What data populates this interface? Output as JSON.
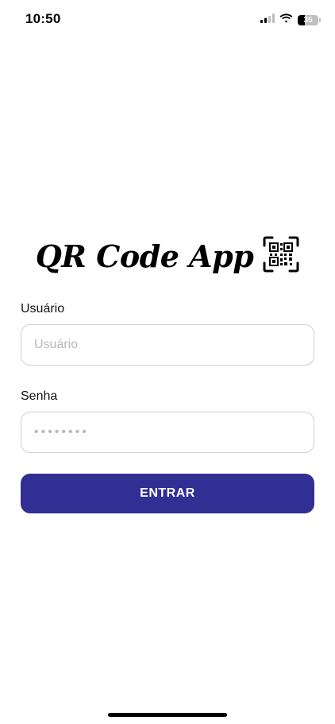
{
  "status_bar": {
    "time": "10:50",
    "battery_level": "35",
    "signal_icon": "cellular-signal-icon",
    "wifi_icon": "wifi-icon",
    "battery_icon": "battery-icon"
  },
  "header": {
    "title": "QR Code App",
    "logo_icon": "qr-code-icon"
  },
  "form": {
    "username": {
      "label": "Usuário",
      "placeholder": "Usuário",
      "value": ""
    },
    "password": {
      "label": "Senha",
      "placeholder": "••••••••",
      "value": ""
    },
    "submit_label": "ENTRAR"
  },
  "colors": {
    "primary": "#312e94",
    "input_border": "#cfcfcf",
    "placeholder": "#b8b8b8"
  }
}
